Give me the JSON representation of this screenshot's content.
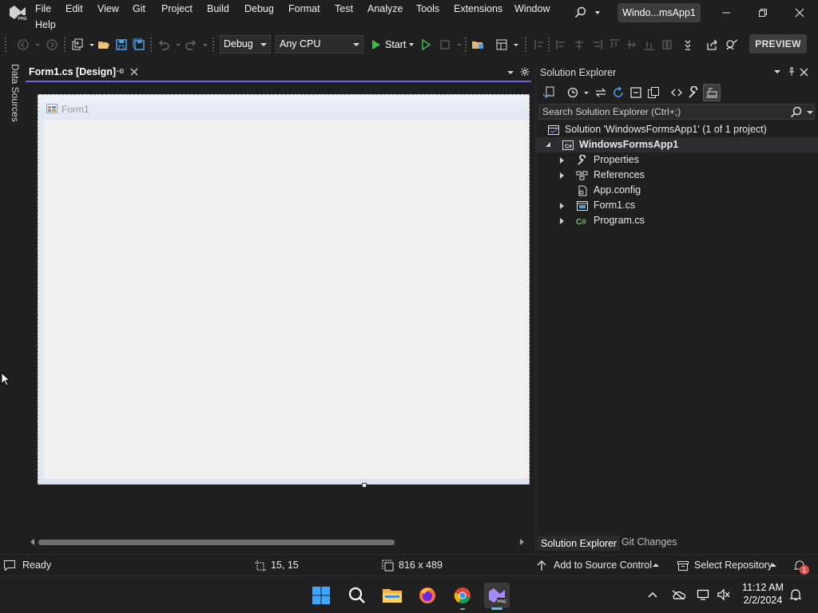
{
  "menubar": {
    "items": [
      "File",
      "Edit",
      "View",
      "Git",
      "Project",
      "Build",
      "Debug",
      "Format",
      "Test",
      "Analyze",
      "Tools",
      "Extensions",
      "Window",
      "Help"
    ],
    "window_title": "Windo...msApp1"
  },
  "toolbar": {
    "configuration": "Debug",
    "platform": "Any CPU",
    "start_label": "Start",
    "preview_label": "PREVIEW"
  },
  "left_strip": {
    "data_sources_label": "Data Sources"
  },
  "document": {
    "tab_label": "Form1.cs [Design]",
    "form_title": "Form1"
  },
  "solution_explorer": {
    "title": "Solution Explorer",
    "search_placeholder": "Search Solution Explorer (Ctrl+;)",
    "solution_label": "Solution 'WindowsFormsApp1' (1 of 1 project)",
    "project_label": "WindowsFormsApp1",
    "items": [
      {
        "label": "Properties",
        "icon": "wrench-icon"
      },
      {
        "label": "References",
        "icon": "references-icon"
      },
      {
        "label": "App.config",
        "icon": "config-file-icon"
      },
      {
        "label": "Form1.cs",
        "icon": "form-file-icon"
      },
      {
        "label": "Program.cs",
        "icon": "csharp-file-icon"
      }
    ],
    "tabs": [
      "Solution Explorer",
      "Git Changes"
    ]
  },
  "statusbar": {
    "ready": "Ready",
    "position": "15, 15",
    "size": "816 x 489",
    "add_to_source_control": "Add to Source Control",
    "select_repository": "Select Repository",
    "notification_count": "1"
  },
  "taskbar": {
    "time": "11:12 AM",
    "date": "2/2/2024"
  },
  "colors": {
    "accent": "#7160e8",
    "background": "#1f1f1f",
    "form_surface": "#f0f0f0"
  }
}
